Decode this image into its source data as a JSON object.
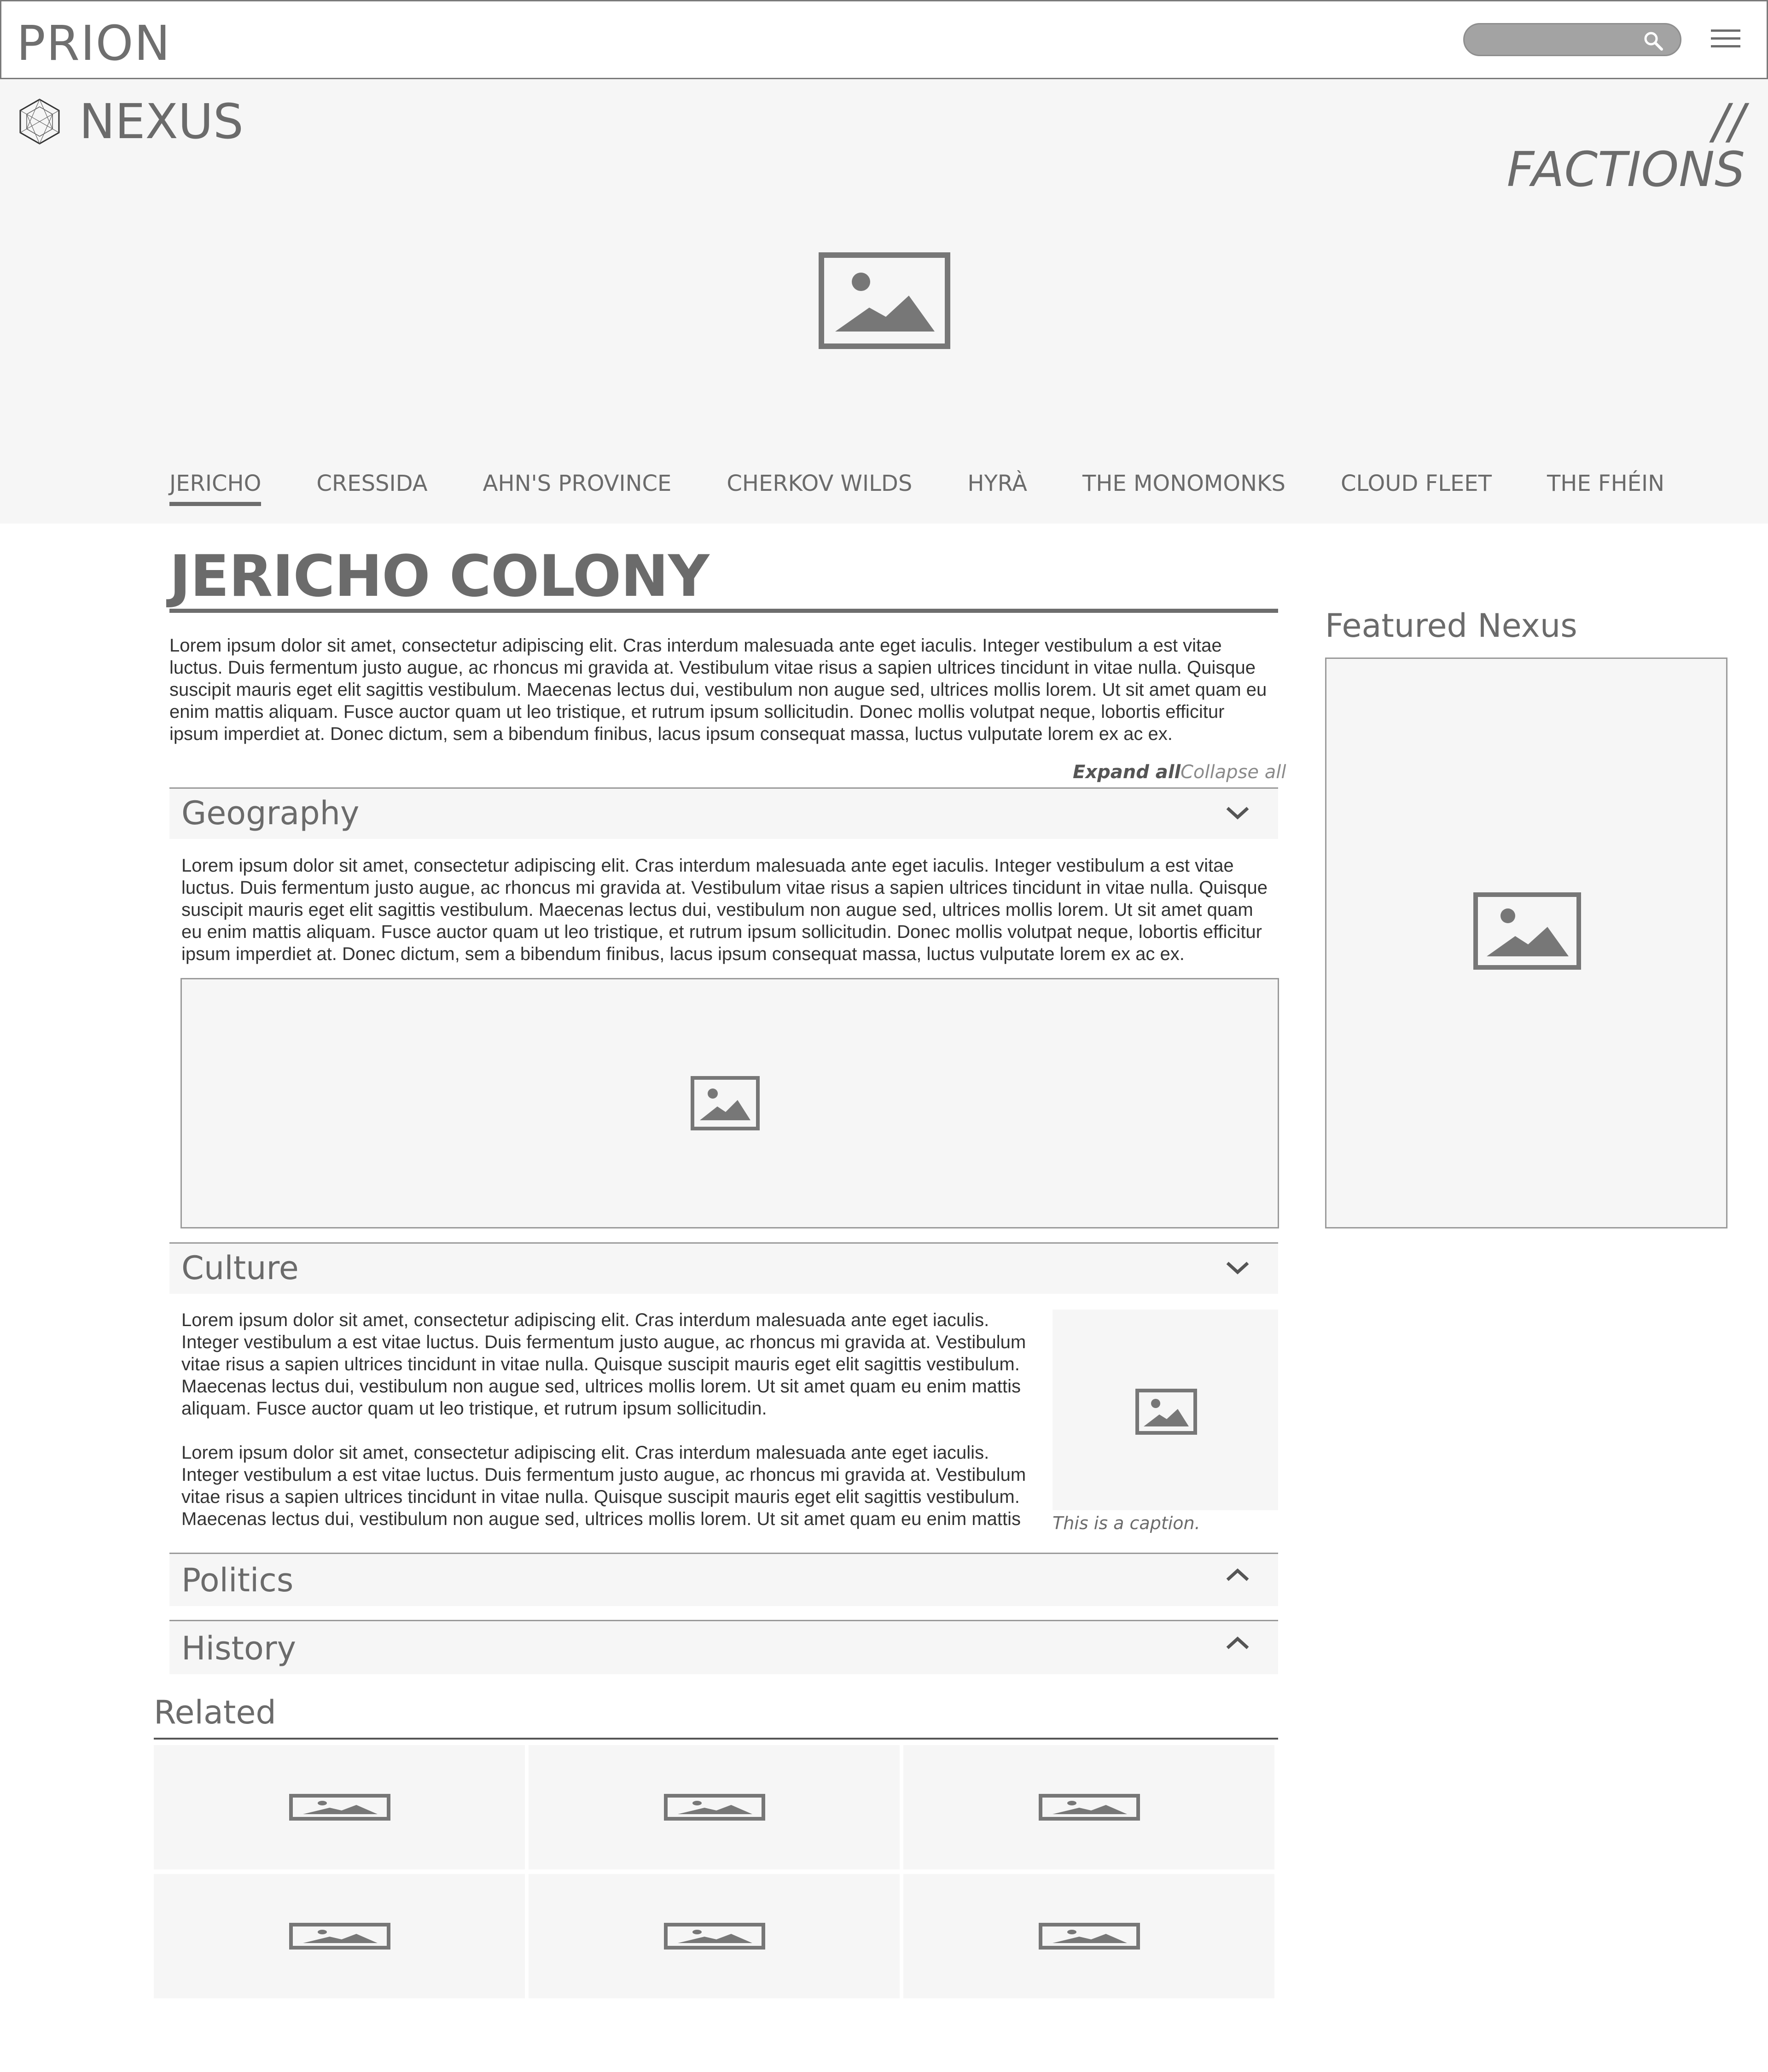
{
  "header": {
    "brand": "PRION",
    "search": {
      "value": "",
      "placeholder": ""
    },
    "search_icon": "search-icon",
    "menu_icon": "hamburger-menu-icon"
  },
  "hero": {
    "logo_icon": "hexagon-wireframe-icon",
    "section_name": "NEXUS",
    "section_tag": "// FACTIONS",
    "image_icon": "image-placeholder-icon"
  },
  "nav": {
    "tabs": [
      {
        "label": "JERICHO",
        "active": true
      },
      {
        "label": "CRESSIDA",
        "active": false
      },
      {
        "label": "AHN'S PROVINCE",
        "active": false
      },
      {
        "label": "CHERKOV WILDS",
        "active": false
      },
      {
        "label": "HYRÀ",
        "active": false
      },
      {
        "label": "THE MONOMONKS",
        "active": false
      },
      {
        "label": "CLOUD FLEET",
        "active": false
      },
      {
        "label": "THE FHÉIN",
        "active": false
      }
    ]
  },
  "main": {
    "title": "JERICHO COLONY",
    "intro": "Lorem ipsum dolor sit amet, consectetur adipiscing elit. Cras interdum malesuada ante eget iaculis. Integer vestibulum a est vitae luctus. Duis fermentum justo augue, ac rhoncus mi gravida at. Vestibulum vitae risus a sapien ultrices tincidunt in vitae nulla. Quisque suscipit mauris eget elit sagittis vestibulum. Maecenas lectus dui, vestibulum non augue sed, ultrices mollis lorem. Ut sit amet quam eu enim mattis aliquam. Fusce auctor quam ut leo tristique, et rutrum ipsum sollicitudin. Donec mollis volutpat neque, lobortis efficitur ipsum imperdiet at. Donec dictum, sem a bibendum finibus, lacus ipsum consequat massa, luctus vulputate lorem ex ac ex.",
    "expand_all": "Expand all",
    "collapse_all": "Collapse all",
    "sections": {
      "geography": {
        "title": "Geography",
        "expanded": true,
        "text": "Lorem ipsum dolor sit amet, consectetur adipiscing elit. Cras interdum malesuada ante eget iaculis. Integer vestibulum a est vitae luctus. Duis fermentum justo augue, ac rhoncus mi gravida at. Vestibulum vitae risus a sapien ultrices tincidunt in vitae nulla. Quisque suscipit mauris eget elit sagittis vestibulum. Maecenas lectus dui, vestibulum non augue sed, ultrices mollis lorem. Ut sit amet quam eu enim mattis aliquam. Fusce auctor quam ut leo tristique, et rutrum ipsum sollicitudin. Donec mollis volutpat neque, lobortis efficitur ipsum imperdiet at. Donec dictum, sem a bibendum finibus, lacus ipsum consequat massa, luctus vulputate lorem ex ac ex."
      },
      "culture": {
        "title": "Culture",
        "expanded": true,
        "paragraph_1": "Lorem ipsum dolor sit amet, consectetur adipiscing elit. Cras interdum malesuada ante eget iaculis. Integer vestibulum a est vitae luctus. Duis fermentum justo augue, ac rhoncus mi gravida at. Vestibulum vitae risus a sapien ultrices tincidunt in vitae nulla. Quisque suscipit mauris eget elit sagittis vestibulum. Maecenas lectus dui, vestibulum non augue sed, ultrices mollis lorem. Ut sit amet quam eu enim mattis aliquam. Fusce auctor quam ut leo tristique, et rutrum ipsum sollicitudin.",
        "paragraph_2": "Lorem ipsum dolor sit amet, consectetur adipiscing elit. Cras interdum malesuada ante eget iaculis. Integer vestibulum a est vitae luctus. Duis fermentum justo augue, ac rhoncus mi gravida at. Vestibulum vitae risus a sapien ultrices tincidunt in vitae nulla. Quisque suscipit mauris eget elit sagittis vestibulum. Maecenas lectus dui, vestibulum non augue sed, ultrices mollis lorem. Ut sit amet quam eu enim mattis",
        "caption": "This is a caption."
      },
      "politics": {
        "title": "Politics",
        "expanded": false
      },
      "history": {
        "title": "History",
        "expanded": false
      }
    }
  },
  "related": {
    "title": "Related",
    "cards": [
      "image-placeholder-icon",
      "image-placeholder-icon",
      "image-placeholder-icon",
      "image-placeholder-icon",
      "image-placeholder-icon",
      "image-placeholder-icon"
    ]
  },
  "sidebar": {
    "featured_title": "Featured Nexus",
    "featured_icon": "image-placeholder-icon"
  },
  "colors": {
    "hero_background": "#f6f6f6",
    "text_gray": "#6b6b6b",
    "search_pill": "#a3a3a3",
    "border": "#9a9a9a"
  }
}
